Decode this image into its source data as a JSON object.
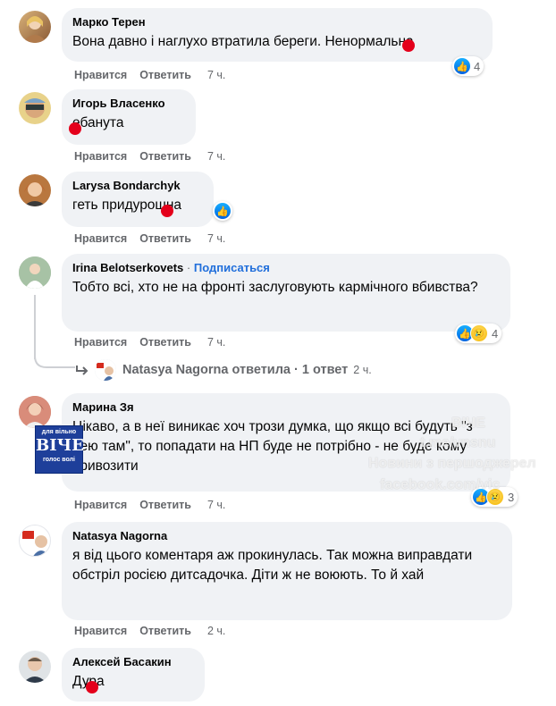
{
  "labels": {
    "like": "Нравится",
    "reply": "Ответить"
  },
  "comments": [
    {
      "author": "Марко Терен",
      "text": "Вона давно і наглухо втратила береги. Ненормальна",
      "time": "7 ч.",
      "reactions": "4"
    },
    {
      "author": "Игорь Власенко",
      "text": "ебанута",
      "time": "7 ч."
    },
    {
      "author": "Larysa Bondarchyk",
      "text": "геть придурошна",
      "time": "7 ч."
    },
    {
      "author": "Irina Belotserkovets",
      "separator": "·",
      "follow": "Подписаться",
      "text": "Тобто всі, хто не на фронті заслуговують кармічного вбивства?",
      "time": "7 ч.",
      "reactions": "4"
    },
    {
      "author": "Марина Зя",
      "text": "Цікаво, а в неї виникає хоч трози думка, що якщо всі будуть \"з нею там\", то попадати на НП буде не потрібно - не буде кому привозити",
      "time": "7 ч.",
      "reactions": "3"
    },
    {
      "author": "Natasya Nagorna",
      "text": "я від цього коментаря аж прокинулась. Так можна виправдати обстріл росією дитсадочка. Діти ж не воюють. То й хай",
      "time": "2 ч."
    },
    {
      "author": "Алексей Басакин",
      "text": "Дура"
    }
  ],
  "reply_thread": {
    "name": "Natasya Nagorna",
    "replied": "ответила",
    "separator": "·",
    "count": "1 ответ",
    "time": "2 ч."
  },
  "watermark": {
    "logo_top": "для вільно",
    "logo_main": "ВІЧЕ",
    "logo_bottom": "голос волі",
    "lines": [
      "ВІЧЕ",
      "t.me/vnsnu",
      "Новини з першоджерел",
      "facebook.com/vic"
    ]
  },
  "icons": {
    "like": "thumbs-up-icon",
    "sad": "sad-face-icon",
    "reply_arrow": "reply-arrow-icon"
  },
  "colors": {
    "bubble": "#f0f2f5",
    "meta": "#65676b",
    "link": "#216fdb",
    "like": "#1877f2",
    "redact": "#e4001b"
  }
}
